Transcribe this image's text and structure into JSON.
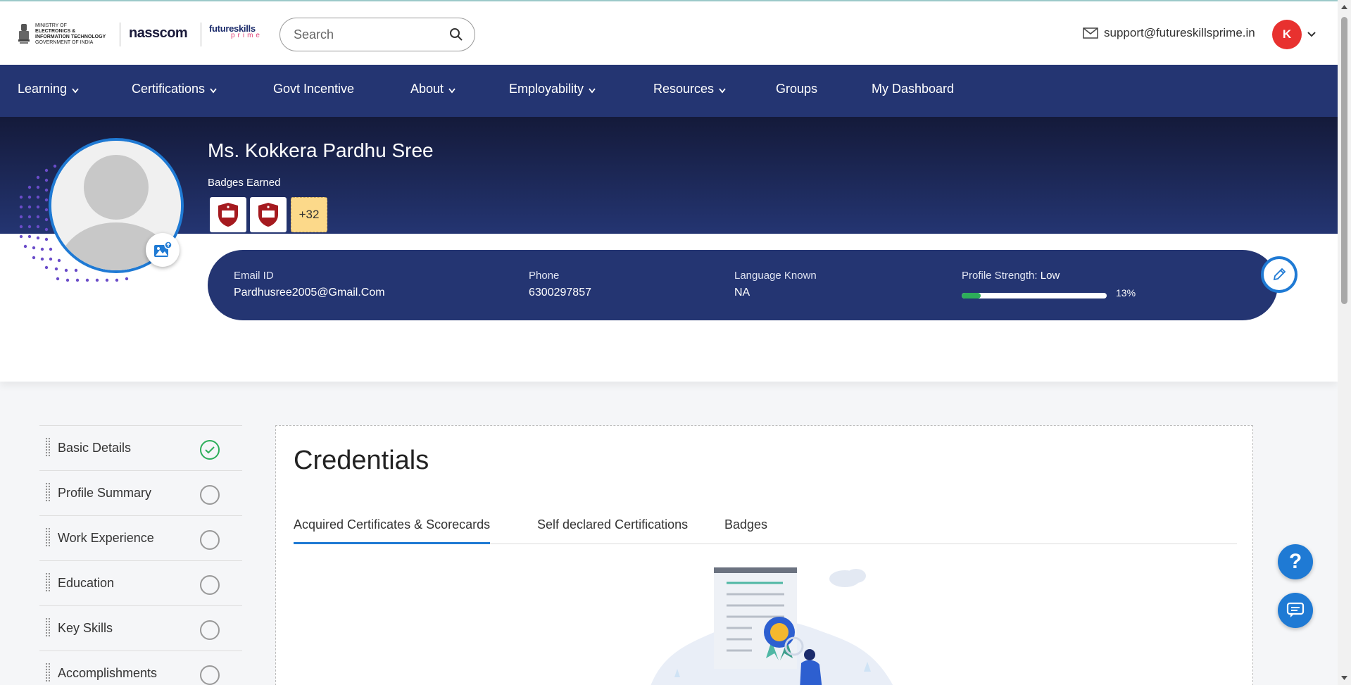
{
  "header": {
    "gov_logo": {
      "line1": "MINISTRY OF",
      "line2": "ELECTRONICS &",
      "line3": "INFORMATION TECHNOLOGY",
      "line4": "GOVERNMENT OF INDIA"
    },
    "nasscom_logo": "nasscom",
    "fsp_logo": {
      "top": "futureskills",
      "bottom": "prime"
    },
    "search_placeholder": "Search",
    "support_email": "support@futureskillsprime.in",
    "user_initial": "K"
  },
  "nav": {
    "items": [
      {
        "label": "Learning",
        "dropdown": true
      },
      {
        "label": "Certifications",
        "dropdown": true
      },
      {
        "label": "Govt Incentive",
        "dropdown": false
      },
      {
        "label": "About",
        "dropdown": true
      },
      {
        "label": "Employability",
        "dropdown": true
      },
      {
        "label": "Resources",
        "dropdown": true
      },
      {
        "label": "Groups",
        "dropdown": false
      },
      {
        "label": "My Dashboard",
        "dropdown": false
      }
    ]
  },
  "profile": {
    "name": "Ms. Kokkera Pardhu Sree",
    "badges_label": "Badges Earned",
    "badges_more": "+32",
    "email_label": "Email ID",
    "email_value": "Pardhusree2005@Gmail.Com",
    "phone_label": "Phone",
    "phone_value": "6300297857",
    "language_label": "Language Known",
    "language_value": "NA",
    "strength_label": "Profile Strength: ",
    "strength_level": "Low",
    "strength_percent": "13%",
    "strength_fraction": 0.13
  },
  "checklist": {
    "items": [
      {
        "label": "Basic Details",
        "done": true
      },
      {
        "label": "Profile Summary",
        "done": false
      },
      {
        "label": "Work Experience",
        "done": false
      },
      {
        "label": "Education",
        "done": false
      },
      {
        "label": "Key Skills",
        "done": false
      },
      {
        "label": "Accomplishments",
        "done": false
      }
    ]
  },
  "credentials": {
    "title": "Credentials",
    "tabs": [
      {
        "label": "Acquired Certificates & Scorecards",
        "active": true
      },
      {
        "label": "Self declared Certifications",
        "active": false
      },
      {
        "label": "Badges",
        "active": false
      }
    ]
  },
  "colors": {
    "nav_bg": "#243572",
    "accent_blue": "#1f7ad4",
    "success_green": "#2dae5a",
    "avatar_red": "#e8312f"
  },
  "icons": {
    "search": "search-icon",
    "mail": "mail-icon",
    "chevron": "chevron-down-icon",
    "edit": "pencil-icon",
    "upload_photo": "image-upload-icon",
    "help": "help-icon",
    "chat": "chat-icon"
  }
}
